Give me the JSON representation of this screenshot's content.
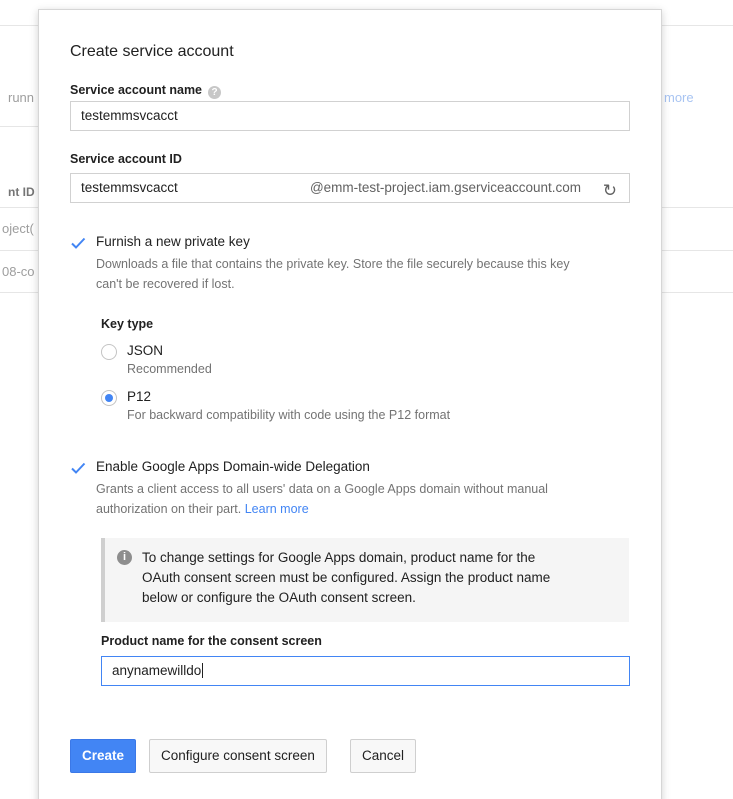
{
  "background": {
    "left_fragments": [
      "runn",
      "nt ID",
      "oject(",
      "08-co"
    ],
    "right_fragment": "more"
  },
  "dialog": {
    "title": "Create service account",
    "name_field": {
      "label": "Service account name",
      "value": "testemmsvcacct"
    },
    "id_field": {
      "label": "Service account ID",
      "value": "testemmsvcacct",
      "suffix": "@emm-test-project.iam.gserviceaccount.com"
    },
    "private_key": {
      "checked": true,
      "label": "Furnish a new private key",
      "desc_line1": "Downloads a file that contains the private key. Store the file securely because this key",
      "desc_line2": "can't be recovered if lost."
    },
    "key_type": {
      "label": "Key type",
      "options": [
        {
          "label": "JSON",
          "sub": "Recommended",
          "selected": false
        },
        {
          "label": "P12",
          "sub": "For backward compatibility with code using the P12 format",
          "selected": true
        }
      ]
    },
    "delegation": {
      "checked": true,
      "label": "Enable Google Apps Domain-wide Delegation",
      "desc_line1": "Grants a client access to all users' data on a Google Apps domain without manual",
      "desc_line2": "authorization on their part.",
      "learn_more": "Learn more"
    },
    "notice": {
      "line1": "To change settings for Google Apps domain, product name for the",
      "line2": "OAuth consent screen must be configured. Assign the product name",
      "line3": "below or configure the OAuth consent screen."
    },
    "product_name": {
      "label": "Product name for the consent screen",
      "value": "anynamewilldo"
    },
    "buttons": {
      "create": "Create",
      "configure": "Configure consent screen",
      "cancel": "Cancel"
    }
  },
  "colors": {
    "accent": "#4285f4",
    "muted": "#737373"
  }
}
